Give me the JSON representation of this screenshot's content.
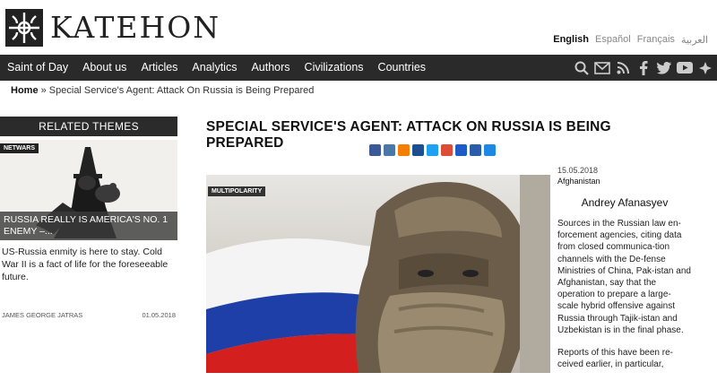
{
  "header": {
    "logo_text": "KATEHON",
    "languages": [
      "English",
      "Español",
      "Français",
      "العربية"
    ],
    "active_language": "English"
  },
  "nav": {
    "items": [
      "Saint of Day",
      "About us",
      "Articles",
      "Analytics",
      "Authors",
      "Civilizations",
      "Countries"
    ],
    "icons": [
      "search-icon",
      "mail-icon",
      "rss-icon",
      "facebook-icon",
      "twitter-icon",
      "youtube-icon",
      "menu-icon"
    ]
  },
  "breadcrumb": {
    "home": "Home",
    "separator": " » ",
    "current": "Special Service's Agent: Attack On Russia is Being Prepared"
  },
  "sidebar": {
    "heading": "RELATED THEMES",
    "card": {
      "tag": "NETWARS",
      "title": "RUSSIA REALLY IS AMERICA'S NO. 1 ENEMY –...",
      "excerpt": "US-Russia enmity is here to stay. Cold War II is a fact of life for the foreseeable future.",
      "author": "JAMES GEORGE JATRAS",
      "date": "01.05.2018"
    }
  },
  "article": {
    "title": "SPECIAL SERVICE'S AGENT: ATTACK ON RUSSIA IS BEING PREPARED",
    "image_tag": "MULTIPOLARITY",
    "date": "15.05.2018",
    "category": "Afghanistan",
    "author": "Andrey Afanasyev",
    "paragraphs": [
      "Sources in the Russian law en-forcement agencies, citing data from closed communica-tion channels with the De-fense Ministries of China, Pak-istan and Afghanistan, say that the operation to prepare a large-scale hybrid offensive against Russia through Tajik-istan and Uzbekistan is in the final phase.",
      "Reports of this have been re-ceived earlier, in particular,"
    ]
  },
  "share_icons": [
    {
      "name": "facebook-share-icon",
      "color": "#3b5998"
    },
    {
      "name": "vk-share-icon",
      "color": "#4a76a8"
    },
    {
      "name": "blogger-share-icon",
      "color": "#f57d00"
    },
    {
      "name": "livejournal-share-icon",
      "color": "#1d4e8f"
    },
    {
      "name": "twitter-share-icon",
      "color": "#1da1f2"
    },
    {
      "name": "googleplus-share-icon",
      "color": "#dd4b39"
    },
    {
      "name": "email-share-icon",
      "color": "#1e5bc6"
    },
    {
      "name": "print-share-icon",
      "color": "#2a5caa"
    },
    {
      "name": "more-share-icon",
      "color": "#1e88e5"
    }
  ]
}
